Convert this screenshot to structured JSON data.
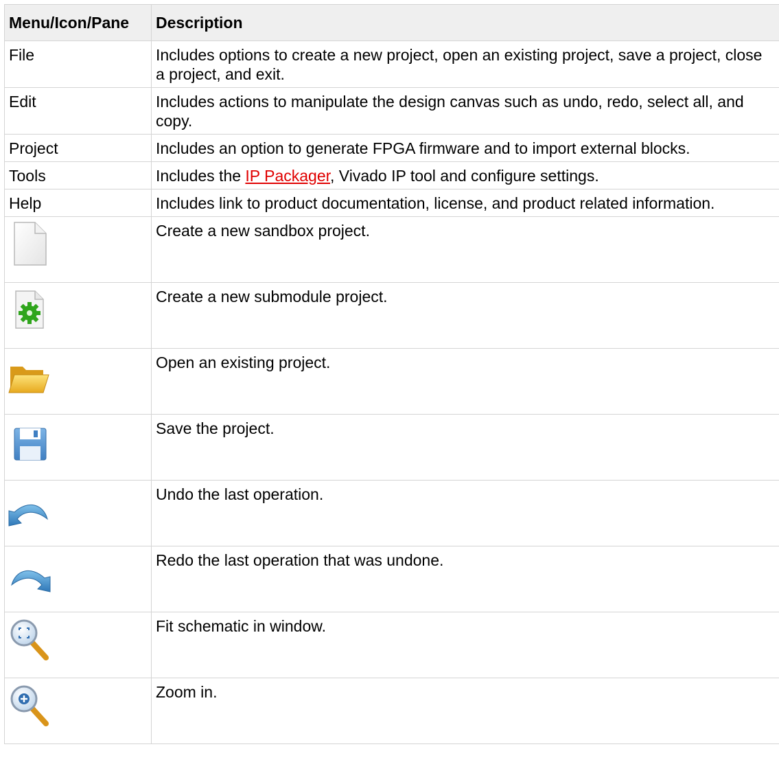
{
  "table": {
    "headers": [
      "Menu/Icon/Pane",
      "Description"
    ],
    "menu_rows": [
      {
        "name": "File",
        "desc": "Includes options to create a new project, open an existing project, save a project, close a project, and exit."
      },
      {
        "name": "Edit",
        "desc": "Includes actions to manipulate the design canvas such as undo, redo, select all, and copy."
      },
      {
        "name": "Project",
        "desc": "Includes an option to generate FPGA firmware and to import external blocks."
      },
      {
        "name": "Help",
        "desc": "Includes link to product documentation, license, and product related information."
      }
    ],
    "tools_row": {
      "name": "Tools",
      "desc_before": "Includes the ",
      "link_text": "IP Packager",
      "desc_after": ", Vivado IP tool and configure settings."
    },
    "icon_rows": [
      {
        "icon": "new-file-icon",
        "desc": "Create a new sandbox project."
      },
      {
        "icon": "new-submodule-icon",
        "desc": "Create a new submodule project."
      },
      {
        "icon": "open-folder-icon",
        "desc": "Open an existing project."
      },
      {
        "icon": "save-floppy-icon",
        "desc": "Save the project."
      },
      {
        "icon": "undo-arrow-icon",
        "desc": "Undo the last operation."
      },
      {
        "icon": "redo-arrow-icon",
        "desc": "Redo the last operation that was undone."
      },
      {
        "icon": "zoom-fit-icon",
        "desc": "Fit schematic in window."
      },
      {
        "icon": "zoom-in-icon",
        "desc": "Zoom in."
      }
    ]
  },
  "colors": {
    "header_bg": "#efefef",
    "border": "#d4d4d4",
    "link": "#e00000"
  }
}
